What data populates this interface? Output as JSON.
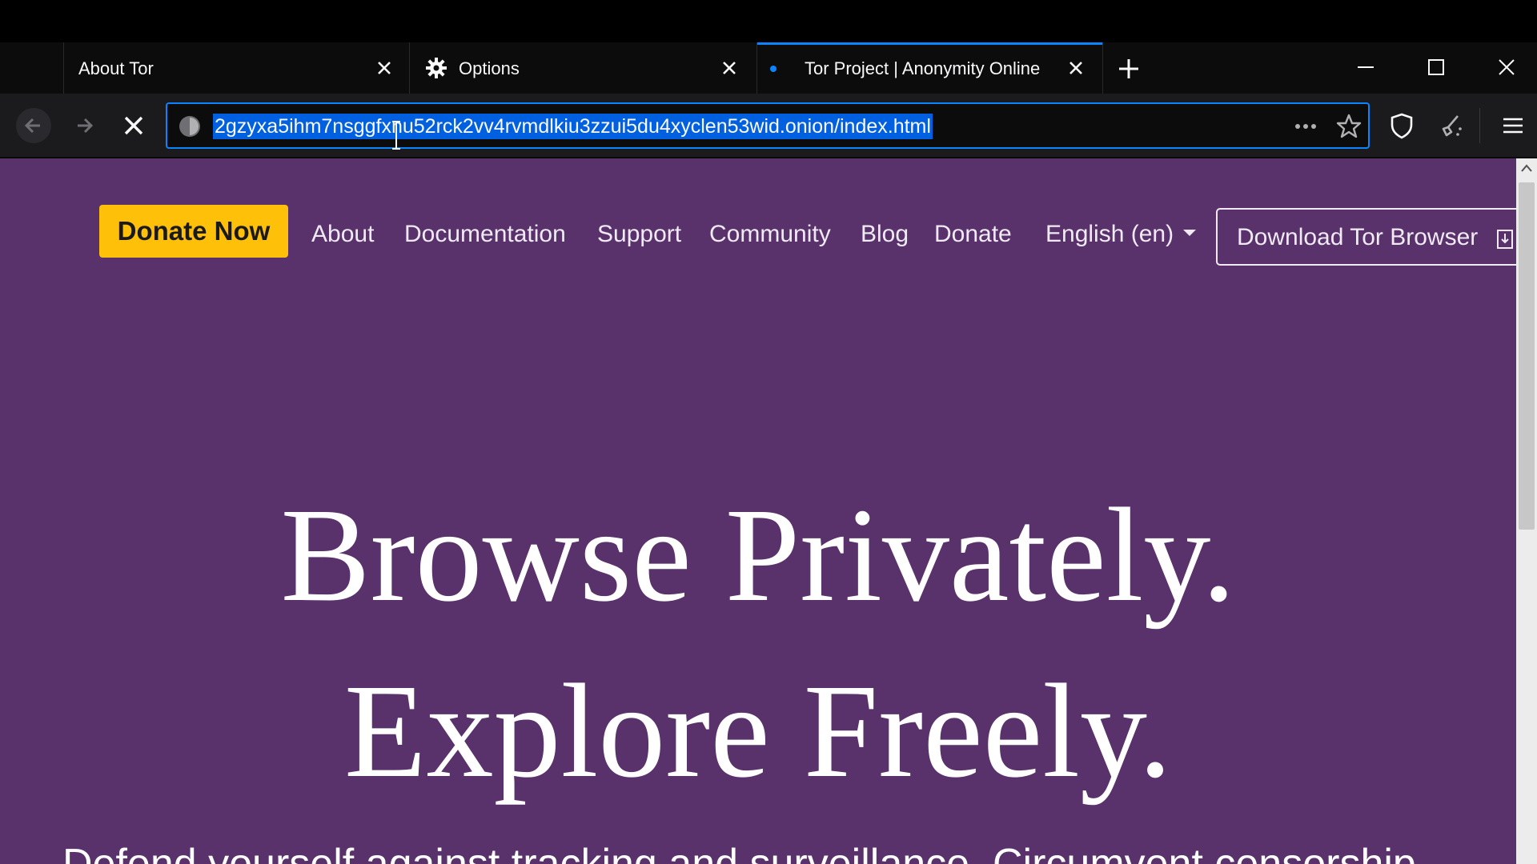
{
  "browser": {
    "tabs": [
      {
        "label": "About Tor",
        "active": false,
        "icon": ""
      },
      {
        "label": "Options",
        "active": false,
        "icon": "gear-icon"
      },
      {
        "label": "Tor Project | Anonymity Online",
        "active": true,
        "icon": "loading-dot"
      }
    ],
    "url": "2gzyxa5ihm7nsggfxnu52rck2vv4rvmdlkiu3zzui5du4xyclen53wid.onion/index.html",
    "accent_color": "#0a84ff"
  },
  "site": {
    "donate_now": "Donate Now",
    "nav": [
      "About",
      "Documentation",
      "Support",
      "Community",
      "Blog",
      "Donate"
    ],
    "language": "English (en)",
    "download": "Download Tor Browser",
    "hero_line1": "Browse Privately.",
    "hero_line2": "Explore Freely.",
    "subline": "Defend yourself against tracking and surveillance. Circumvent censorship.",
    "bg_color": "#59316b",
    "donate_color": "#ffc00a"
  }
}
